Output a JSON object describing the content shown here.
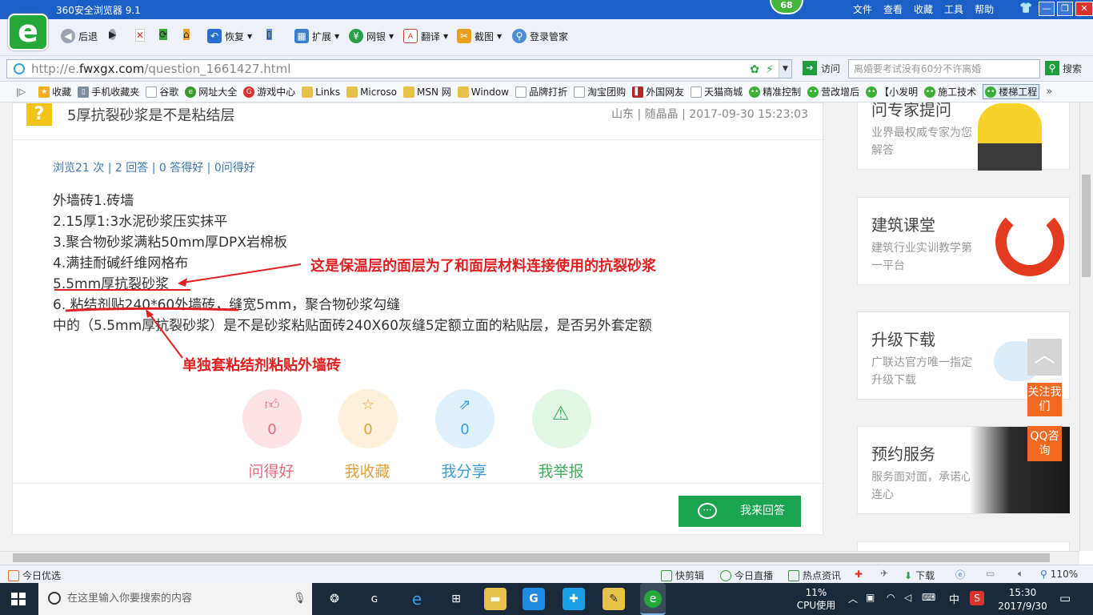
{
  "window": {
    "title": "360安全浏览器 9.1",
    "badge": "68",
    "menus": [
      "文件",
      "查看",
      "收藏",
      "工具",
      "帮助"
    ]
  },
  "toolbar": {
    "back": "后退",
    "restore": "恢复",
    "extend": "扩展",
    "bank": "网银",
    "translate": "翻译",
    "screenshot": "截图",
    "login": "登录管家"
  },
  "address": {
    "url_prefix": "http://e.",
    "url_host": "fwxgx.com",
    "url_path": "/question_1661427.html",
    "visit_label": "访问",
    "search_placeholder": "离婚要考试没有60分不许离婚",
    "search_label": "搜索"
  },
  "bookmarks": [
    {
      "label": "收藏",
      "icon": "star-icon",
      "color": "#f2b01e"
    },
    {
      "label": "手机收藏夹",
      "icon": "phone-icon",
      "color": "#7d8da3"
    },
    {
      "label": "谷歌",
      "icon": "page-icon",
      "color": "#9aa6b8"
    },
    {
      "label": "网址大全",
      "icon": "globe-icon",
      "color": "#3a9a2a"
    },
    {
      "label": "游戏中心",
      "icon": "game-icon",
      "color": "#d9342b"
    },
    {
      "label": "Links",
      "icon": "folder-icon",
      "color": "#e8c14a"
    },
    {
      "label": "Microso",
      "icon": "folder-icon",
      "color": "#e8c14a"
    },
    {
      "label": "MSN 网",
      "icon": "folder-icon",
      "color": "#e8c14a"
    },
    {
      "label": "Window",
      "icon": "folder-icon",
      "color": "#e8c14a"
    },
    {
      "label": "品牌打折",
      "icon": "page-icon",
      "color": "#9aa6b8"
    },
    {
      "label": "淘宝团购",
      "icon": "page-icon",
      "color": "#9aa6b8"
    },
    {
      "label": "外国网友",
      "icon": "flag-icon",
      "color": "#b0282a"
    },
    {
      "label": "天猫商城",
      "icon": "page-icon",
      "color": "#9aa6b8"
    },
    {
      "label": "精准控制",
      "icon": "wechat-icon",
      "color": "#3bb034"
    },
    {
      "label": "营改增后",
      "icon": "wechat-icon",
      "color": "#3bb034"
    },
    {
      "label": "【小发明",
      "icon": "wechat-icon",
      "color": "#3bb034"
    },
    {
      "label": "施工技术",
      "icon": "wechat-icon",
      "color": "#3bb034"
    },
    {
      "label": "楼梯工程",
      "icon": "wechat-icon",
      "color": "#3bb034"
    }
  ],
  "question": {
    "title": "5厚抗裂砂浆是不是粘结层",
    "meta": "山东 | 随晶晶 | 2017-09-30 15:23:03",
    "stats": "浏览21 次 | 2 回答 | 0 答得好 | 0问得好",
    "lines": [
      "外墙砖1.砖墙",
      "2.15厚1:3水泥砂浆压实抹平",
      "3.聚合物砂浆满粘50mm厚DPX岩棉板",
      "4.满挂耐碱纤维网格布",
      "5.5mm厚抗裂砂浆",
      "6. 粘结剂贴240*60外墙砖，缝宽5mm，聚合物砂浆勾缝",
      "中的（5.5mm厚抗裂砂浆）是不是砂浆粘贴面砖240X60灰缝5定额立面的粘贴层，是否另外套定额"
    ],
    "annotation1": "这是保温层的面层为了和面层材料连接使用的抗裂砂浆",
    "annotation2": "单独套粘结剂粘贴外墙砖"
  },
  "actions": [
    {
      "label": "问得好",
      "count": "0",
      "icon": "thumb-up-icon",
      "bg": "#fde3e6",
      "color": "#e46b7a"
    },
    {
      "label": "我收藏",
      "count": "0",
      "icon": "star-icon",
      "bg": "#fdf0da",
      "color": "#e0a23c"
    },
    {
      "label": "我分享",
      "count": "0",
      "icon": "share-icon",
      "bg": "#ddf0fb",
      "color": "#3b9ad8"
    },
    {
      "label": "我举报",
      "count": "",
      "icon": "warning-icon",
      "bg": "#e2f6e6",
      "color": "#3fb05c"
    }
  ],
  "answer_button": "我来回答",
  "sidebar": [
    {
      "title": "问专家提问",
      "desc": "业界最权威专家为您解答"
    },
    {
      "title": "建筑课堂",
      "desc": "建筑行业实训教学第一平台"
    },
    {
      "title": "升级下载",
      "desc": "广联达官方唯一指定升级下载"
    },
    {
      "title": "预约服务",
      "desc": "服务面对面，承诺心连心"
    }
  ],
  "floating": {
    "follow": "关注我们",
    "qq": "QQ咨询"
  },
  "statusbar": {
    "left": "今日优选",
    "items": [
      "快剪辑",
      "今日直播",
      "热点资讯",
      "下载"
    ],
    "zoom": "110%"
  },
  "taskbar": {
    "search_placeholder": "在这里输入你要搜索的内容",
    "cpu_percent": "11%",
    "cpu_label": "CPU使用",
    "ime": "中",
    "time": "15:30",
    "date": "2017/9/30"
  }
}
